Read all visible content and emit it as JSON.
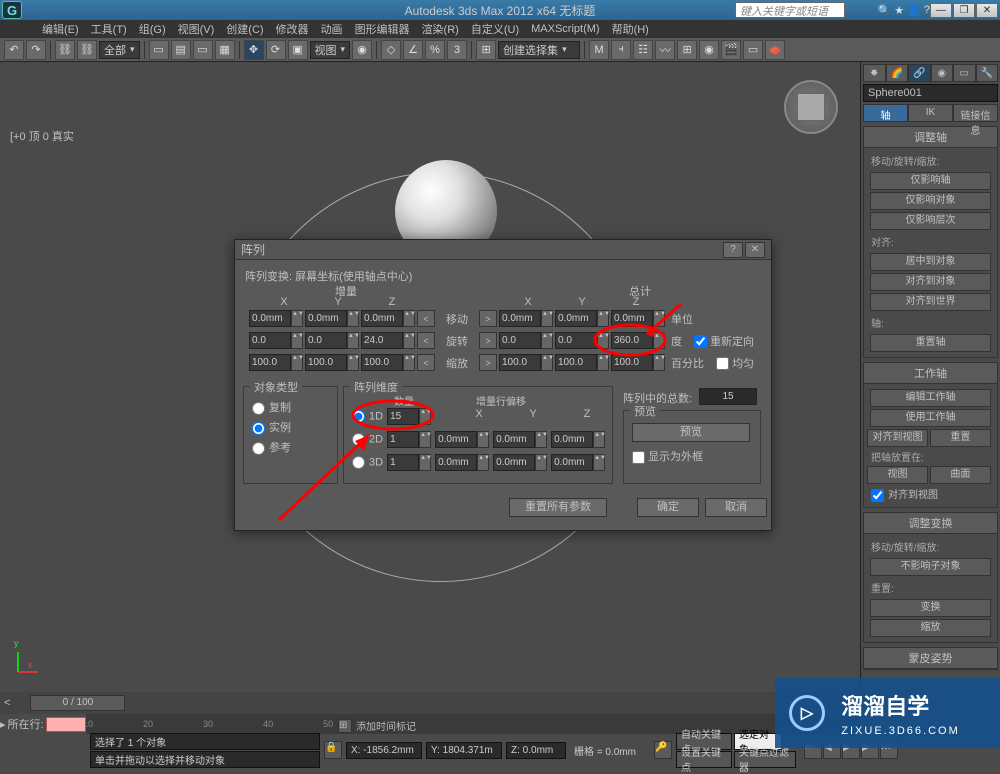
{
  "titlebar": {
    "app_title": "Autodesk 3ds Max 2012 x64   无标题",
    "search_placeholder": "键入关键字或短语",
    "min": "—",
    "restore": "❐",
    "close": "✕"
  },
  "menu": {
    "edit": "编辑(E)",
    "tools": "工具(T)",
    "group": "组(G)",
    "views": "视图(V)",
    "create": "创建(C)",
    "modifiers": "修改器",
    "animation": "动画",
    "graph_editors": "图形编辑器",
    "rendering": "渲染(R)",
    "customize": "自定义(U)",
    "maxscript": "MAXScript(M)",
    "help": "帮助(H)"
  },
  "toolbar": {
    "all": "全部",
    "view": "视图",
    "create_selection": "创建选择集"
  },
  "viewport": {
    "label": "[+0 顶 0 真实"
  },
  "cmdpanel": {
    "obj_name": "Sphere001",
    "tab_pivot": "轴",
    "tab_ik": "IK",
    "tab_link": "链接信息",
    "rollout_adjust_pivot": "调整轴",
    "move_rotate_scale": "移动/旋转/缩放:",
    "affect_pivot_only": "仅影响轴",
    "affect_object_only": "仅影响对象",
    "affect_hierarchy_only": "仅影响层次",
    "alignment": "对齐:",
    "center_to_object": "居中到对象",
    "align_to_object": "对齐到对象",
    "align_to_world": "对齐到世界",
    "pivot": "轴:",
    "reset_pivot": "重置轴",
    "rollout_working_pivot": "工作轴",
    "edit_working_pivot": "编辑工作轴",
    "use_working_pivot": "使用工作轴",
    "align_to_view": "对齐到视图",
    "reset": "重置",
    "place_pivot": "把轴放置在:",
    "view_btn": "视图",
    "surface_btn": "曲面",
    "align_to_view_chk": "对齐到视图",
    "rollout_adjust_transform": "调整变换",
    "mrs2": "移动/旋转/缩放:",
    "dont_affect_children": "不影响子对象",
    "reset_group": "重置:",
    "transform": "变换",
    "scale": "缩放",
    "rollout_skin_pose": "蒙皮姿势"
  },
  "dialog": {
    "title": "阵列",
    "help_icon": "?",
    "close_icon": "✕",
    "header": "阵列变换: 屏幕坐标(使用轴点中心)",
    "incremental": "增量",
    "totals": "总计",
    "col_x": "X",
    "col_y": "Y",
    "col_z": "Z",
    "row_move": "移动",
    "row_rotate": "旋转",
    "row_scale": "缩放",
    "units": "单位",
    "degrees": "度",
    "percent": "百分比",
    "reorient": "重新定向",
    "uniform": "均匀",
    "inc": {
      "move_x": "0.0mm",
      "move_y": "0.0mm",
      "move_z": "0.0mm",
      "rot_x": "0.0",
      "rot_y": "0.0",
      "rot_z": "24.0",
      "scale_x": "100.0",
      "scale_y": "100.0",
      "scale_z": "100.0"
    },
    "tot": {
      "move_x": "0.0mm",
      "move_y": "0.0mm",
      "move_z": "0.0mm",
      "rot_x": "0.0",
      "rot_y": "0.0",
      "rot_z": "360.0",
      "scale_x": "100.0",
      "scale_y": "100.0",
      "scale_z": "100.0"
    },
    "obj_type_group": "对象类型",
    "copy": "复制",
    "instance": "实例",
    "reference": "参考",
    "array_dim_group": "阵列维度",
    "count_lbl": "数量",
    "d1": "1D",
    "d1_count": "15",
    "d2": "2D",
    "d2_count": "1",
    "d3": "3D",
    "d3_count": "1",
    "row_offset": "增量行偏移",
    "d2x": "0.0mm",
    "d2y": "0.0mm",
    "d2z": "0.0mm",
    "d3x": "0.0mm",
    "d3y": "0.0mm",
    "d3z": "0.0mm",
    "total_in_array": "阵列中的总数:",
    "total_value": "15",
    "preview_group": "预览",
    "preview_btn": "预览",
    "display_as_box": "显示为外框",
    "reset_all": "重置所有参数",
    "ok": "确定",
    "cancel": "取消"
  },
  "timeslider": {
    "frame": "0 / 100"
  },
  "status": {
    "selected": "选择了 1 个对象",
    "hint": "单击并拖动以选择并移动对象",
    "x": "X: -1856.2mm",
    "y": "Y: 1804.371m",
    "z": "Z: 0.0mm",
    "grid": "栅格 = 0.0mm",
    "autokey": "自动关键点",
    "selected_filter": "选定对象",
    "setkey": "设置关键点",
    "keyfilter": "关键点过滤器",
    "add_time_tag": "添加时间标记",
    "prompt_label": "所在行:"
  },
  "watermark": {
    "brand": "溜溜自学",
    "url": "ZIXUE.3D66.COM"
  }
}
